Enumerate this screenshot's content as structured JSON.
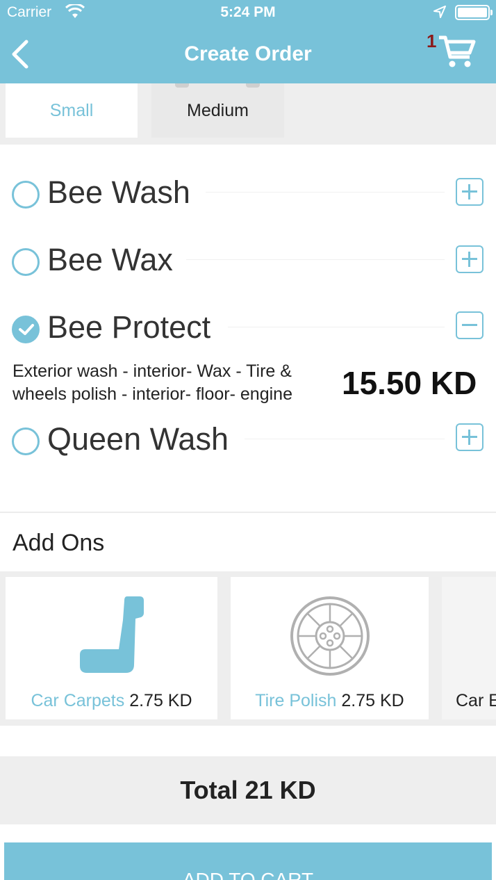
{
  "status_bar": {
    "carrier": "Carrier",
    "time": "5:24 PM"
  },
  "nav": {
    "title": "Create Order",
    "cart_count": "1"
  },
  "size_tabs": [
    {
      "label": "Small",
      "selected": true
    },
    {
      "label": "Medium",
      "selected": false
    }
  ],
  "packages": [
    {
      "name": "Bee Wash",
      "selected": false,
      "toggle": "plus"
    },
    {
      "name": "Bee Wax",
      "selected": false,
      "toggle": "plus"
    },
    {
      "name": "Bee Protect",
      "selected": true,
      "toggle": "minus",
      "description": "Exterior wash - interior- Wax - Tire & wheels polish - interior- floor- engine",
      "price": "15.50 KD"
    },
    {
      "name": "Queen Wash",
      "selected": false,
      "toggle": "plus"
    }
  ],
  "addons": {
    "title": "Add Ons",
    "items": [
      {
        "name": "Car Carpets",
        "price": "2.75 KD",
        "icon": "car-seat-icon"
      },
      {
        "name": "Tire Polish",
        "price": "2.75 KD",
        "icon": "tire-icon"
      },
      {
        "name": "Car E",
        "price": "",
        "icon": ""
      }
    ]
  },
  "total": {
    "label": "Total 21  KD"
  },
  "cart_button": {
    "label": "ADD TO CART"
  },
  "colors": {
    "accent": "#78c2d9",
    "cart_badge": "#8b1a1a",
    "background_gray": "#eeeeee"
  }
}
